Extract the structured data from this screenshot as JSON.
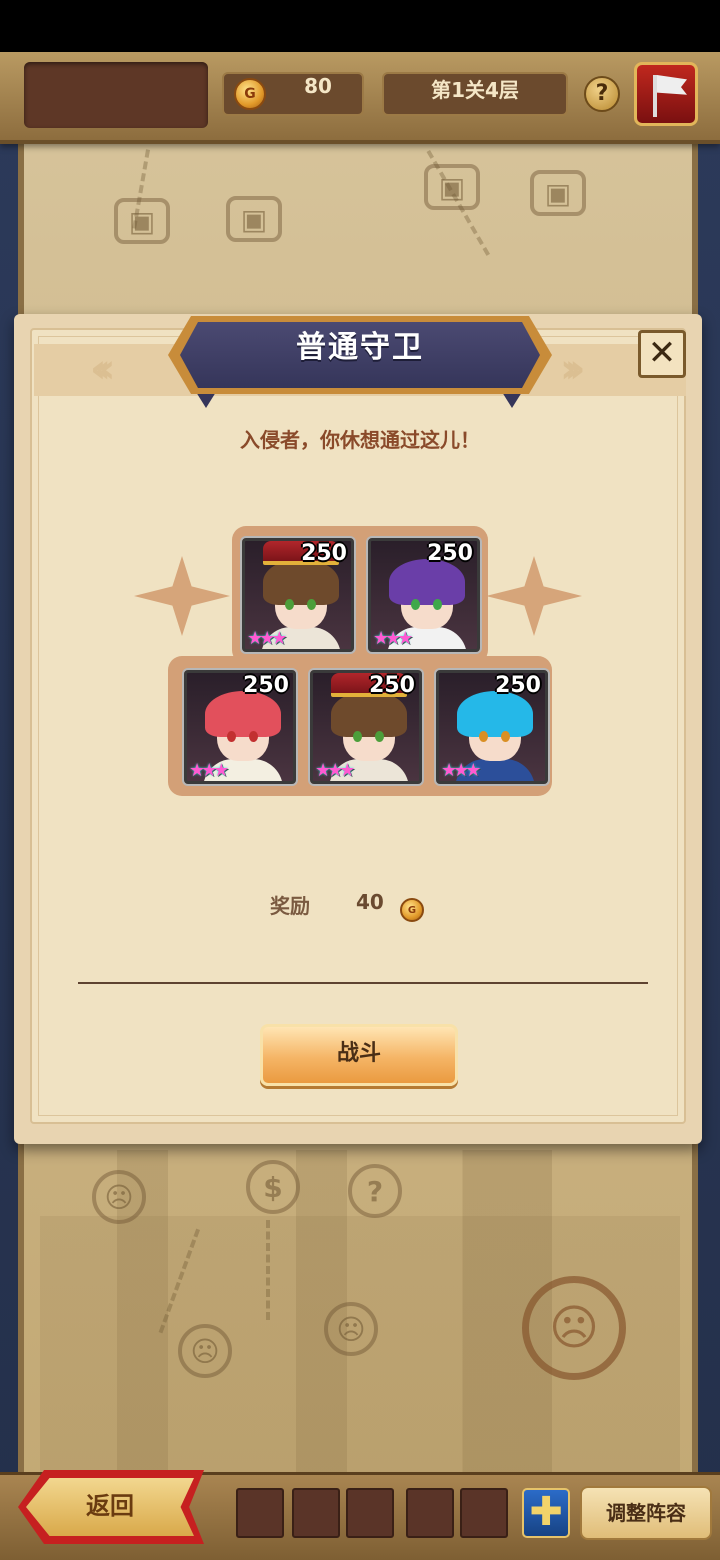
{
  "topbar": {
    "currency_value": "80",
    "stage_label": "第1关4层",
    "help_symbol": "?"
  },
  "map": {
    "node_symbols": {
      "chest": "▣",
      "demon": "☹",
      "money": "$",
      "mystery": "?"
    }
  },
  "modal": {
    "title": "普通守卫",
    "close_symbol": "✕",
    "subtitle": "入侵者，你休想通过这儿！",
    "enemies": [
      {
        "level": "250",
        "stars": "★★★",
        "hair_color": "#6e4a2c",
        "outfit_color": "#ece5d8",
        "eye_color": "#4c9e3a",
        "has_hat": true
      },
      {
        "level": "250",
        "stars": "★★★",
        "hair_color": "#6a3ea8",
        "outfit_color": "#f2f2f2",
        "eye_color": "#3fa84a",
        "has_hat": false
      },
      {
        "level": "250",
        "stars": "★★★",
        "hair_color": "#e2505c",
        "outfit_color": "#f3efe1",
        "eye_color": "#c23030",
        "has_hat": false
      },
      {
        "level": "250",
        "stars": "★★★",
        "hair_color": "#6e4a2c",
        "outfit_color": "#ece5d8",
        "eye_color": "#4c9e3a",
        "has_hat": true
      },
      {
        "level": "250",
        "stars": "★★★",
        "hair_color": "#25b8e8",
        "outfit_color": "#2c4f9a",
        "eye_color": "#d98f24",
        "has_hat": false
      }
    ],
    "reward_label": "奖励",
    "reward_value": "40",
    "fight_label": "战斗"
  },
  "bottombar": {
    "back_label": "返回",
    "plus_symbol": "✚",
    "adjust_label": "调整阵容"
  },
  "colors": {
    "title_ribbon": "#35355a",
    "modal_bg": "#f0e2c2",
    "fight_button": "#f5b566",
    "back_button_border": "#c62020"
  }
}
